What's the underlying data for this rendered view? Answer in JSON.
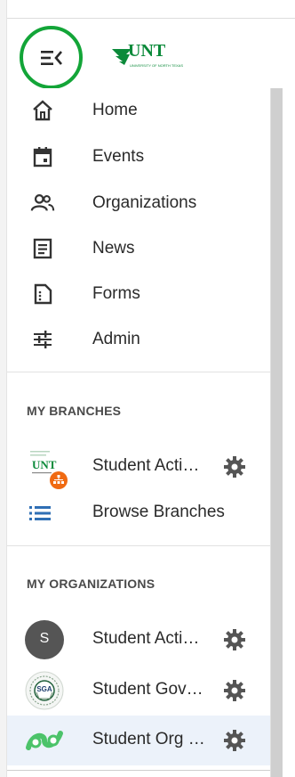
{
  "header": {
    "logo_text": "UNT",
    "logo_subtext": "UNIVERSITY OF NORTH TEXAS"
  },
  "nav": {
    "items": [
      {
        "label": "Home",
        "icon": "home-icon"
      },
      {
        "label": "Events",
        "icon": "calendar-icon"
      },
      {
        "label": "Organizations",
        "icon": "people-icon"
      },
      {
        "label": "News",
        "icon": "news-icon"
      },
      {
        "label": "Forms",
        "icon": "form-icon"
      },
      {
        "label": "Admin",
        "icon": "sliders-icon"
      }
    ]
  },
  "branches": {
    "title": "MY BRANCHES",
    "items": [
      {
        "label": "Student Acti…"
      }
    ],
    "browse_label": "Browse Branches"
  },
  "organizations": {
    "title": "MY ORGANIZATIONS",
    "items": [
      {
        "label": "Student Acti…",
        "avatar_letter": "S"
      },
      {
        "label": "Student Gov…",
        "avatar_text": "SGA"
      },
      {
        "label": "Student Org …"
      }
    ]
  },
  "colors": {
    "accent_green": "#13a538",
    "link_blue": "#2f6fb5",
    "unt_green": "#0b8a3a",
    "badge_orange": "#f06a12"
  }
}
